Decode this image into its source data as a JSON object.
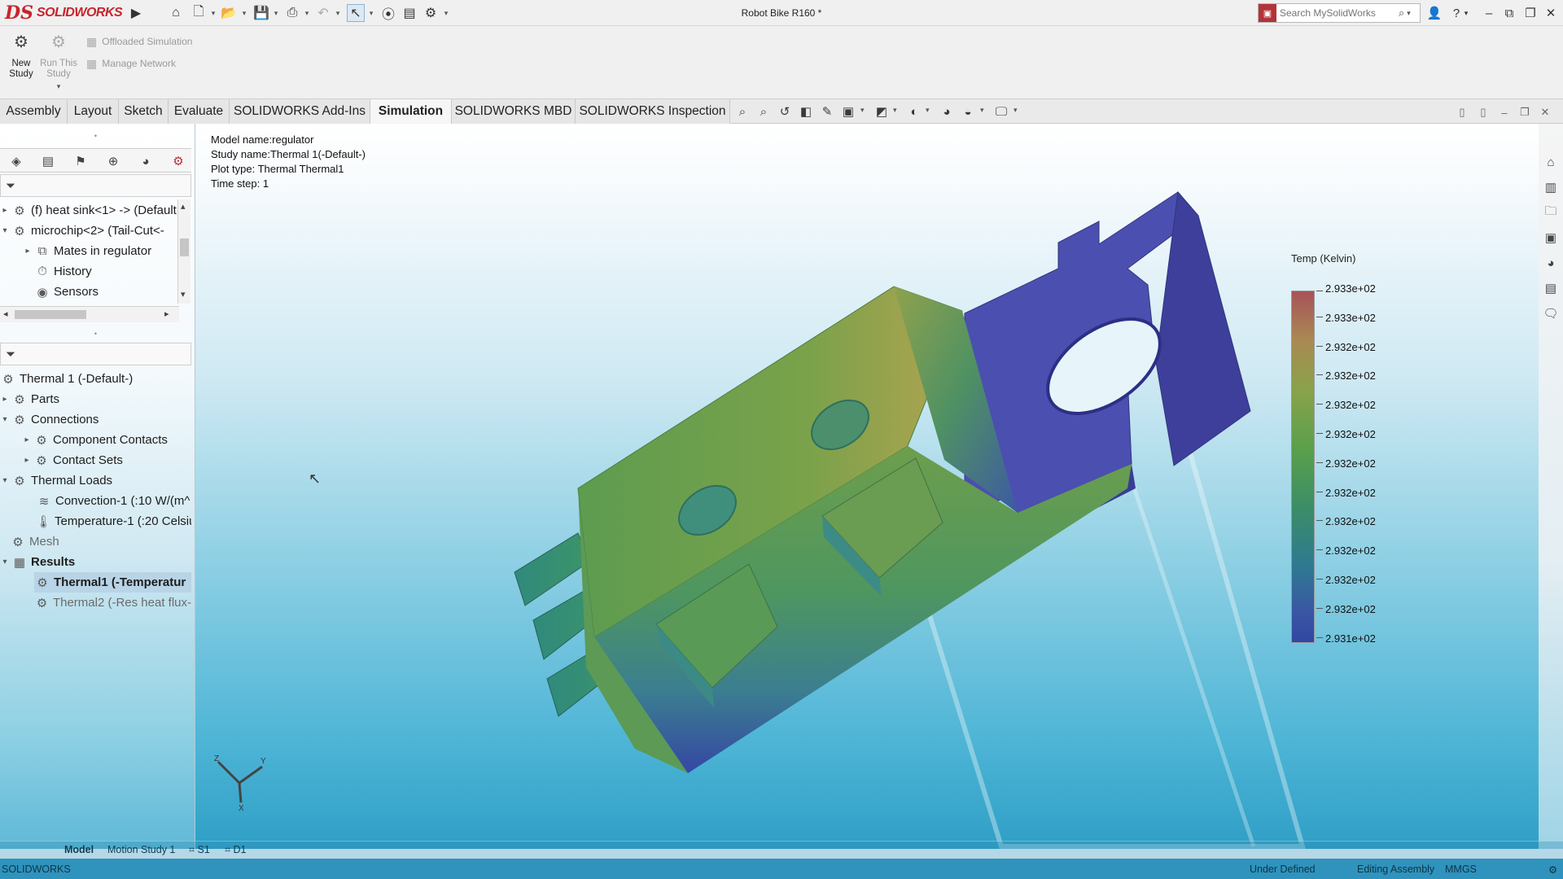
{
  "app": {
    "brand_mark": "DS",
    "brand_name": "SOLIDWORKS",
    "document_title": "Robot Bike R160 *"
  },
  "search": {
    "placeholder": "Search MySolidWorks"
  },
  "command_manager": {
    "new_study": "New Study",
    "run_study": "Run This Study",
    "offloaded": "Offloaded Simulation",
    "manage_network": "Manage Network"
  },
  "tabs": [
    "Assembly",
    "Layout",
    "Sketch",
    "Evaluate",
    "SOLIDWORKS Add-Ins",
    "Simulation",
    "SOLIDWORKS MBD",
    "SOLIDWORKS Inspection"
  ],
  "active_tab": "Simulation",
  "feature_tree": {
    "items": [
      {
        "label": "(f) heat sink<1> -> (Default",
        "icon": "assembly-icon"
      },
      {
        "label": "microchip<2> (Tail-Cut<-",
        "icon": "assembly-icon"
      },
      {
        "label": "Mates in regulator",
        "icon": "mates-icon"
      },
      {
        "label": "History",
        "icon": "history-icon"
      },
      {
        "label": "Sensors",
        "icon": "sensors-icon"
      }
    ]
  },
  "simulation_tree": {
    "root": "Thermal 1 (-Default-)",
    "items": [
      {
        "label": "Parts"
      },
      {
        "label": "Connections"
      },
      {
        "label": "Component Contacts"
      },
      {
        "label": "Contact Sets"
      },
      {
        "label": "Thermal Loads"
      },
      {
        "label": "Convection-1 (:10 W/(m^"
      },
      {
        "label": "Temperature-1 (:20 Celsiu"
      },
      {
        "label": "Mesh"
      },
      {
        "label": "Results"
      },
      {
        "label": "Thermal1 (-Temperatur"
      },
      {
        "label": "Thermal2 (-Res heat flux-"
      }
    ]
  },
  "plot_info": {
    "model_name": "Model name:regulator",
    "study_name": "Study name:Thermal 1(-Default-)",
    "plot_type": "Plot type: Thermal Thermal1",
    "time_step": "Time step: 1"
  },
  "legend": {
    "title": "Temp (Kelvin)",
    "values": [
      "2.933e+02",
      "2.933e+02",
      "2.932e+02",
      "2.932e+02",
      "2.932e+02",
      "2.932e+02",
      "2.932e+02",
      "2.932e+02",
      "2.932e+02",
      "2.932e+02",
      "2.932e+02",
      "2.932e+02",
      "2.931e+02"
    ]
  },
  "triad": {
    "z": "Z",
    "y": "Y",
    "x": "X"
  },
  "bottom_tabs": {
    "model": "Model",
    "motion": "Motion Study 1",
    "s1": "S1",
    "d1": "D1"
  },
  "status": {
    "left": "SOLIDWORKS",
    "state": "Under Defined",
    "mode": "Editing Assembly",
    "units": "MMGS"
  },
  "colors": {
    "accent": "#c8242b",
    "status_bar": "#2f93bd",
    "viewport_bottom": "#2f9fc6"
  }
}
